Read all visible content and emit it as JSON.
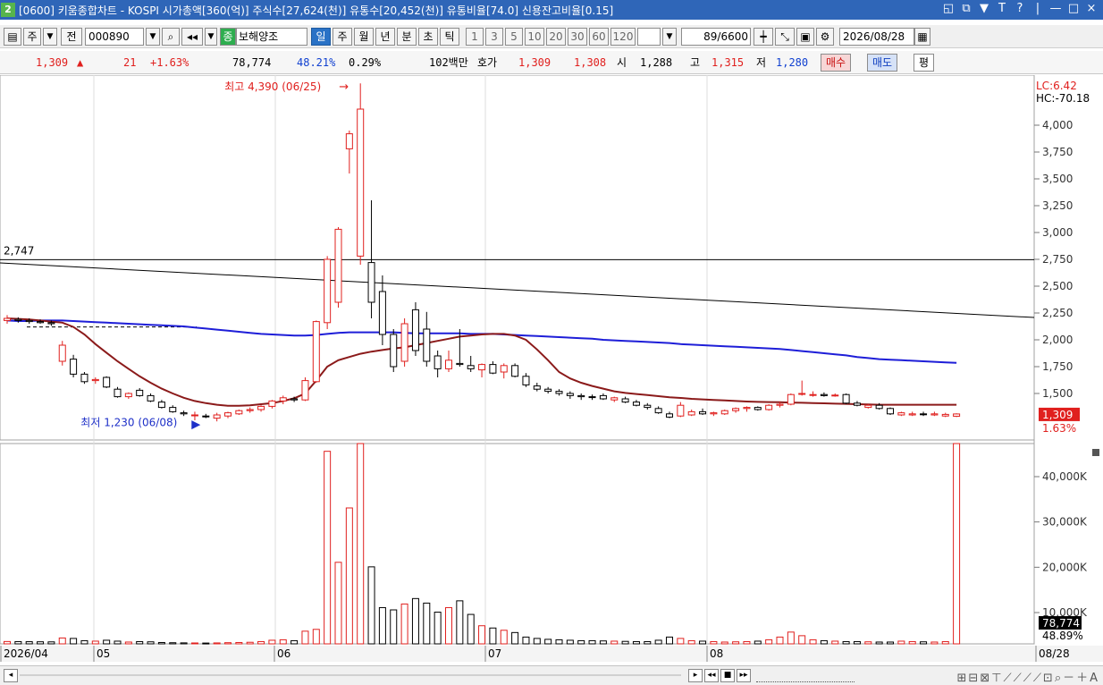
{
  "window": {
    "badge": "2",
    "title": "[0600] 키움종합차트 - KOSPI 시가총액[360(억)] 주식수[27,624(천)] 유통수[20,452(천)] 유통비율[74.0] 신용잔고비율[0.15]",
    "controls": [
      "◱",
      "⧉",
      "▼",
      "T",
      "?",
      "|",
      "—",
      "□",
      "×"
    ]
  },
  "toolbar": {
    "market": "주",
    "all_label": "전",
    "code": "000890",
    "stock_name": "보해양조",
    "badge_label": "종",
    "periods": [
      "일",
      "주",
      "월",
      "년",
      "분",
      "초",
      "틱"
    ],
    "selected_period": "일",
    "intervals": [
      "1",
      "3",
      "5",
      "10",
      "20",
      "30",
      "60",
      "120"
    ],
    "count": "89",
    "count_total": "/6600",
    "date": "2026/08/28"
  },
  "quote": {
    "price": "1,309",
    "change_arrow": "▲",
    "change": "21",
    "change_pct": "+1.63%",
    "volume": "78,774",
    "volume_ratio": "48.21%",
    "turnover": "0.29%",
    "trade_value": "102백만",
    "hoga_label": "호가",
    "ask": "1,309",
    "bid": "1,308",
    "open_label": "시",
    "open": "1,288",
    "high_label": "고",
    "high": "1,315",
    "low_label": "저",
    "low": "1,280",
    "buy_label": "매수",
    "sell_label": "매도",
    "eval_label": "평"
  },
  "price_axis": {
    "labels": [
      "4,000",
      "3,750",
      "3,500",
      "3,250",
      "3,000",
      "2,750",
      "2,500",
      "2,250",
      "2,000",
      "1,750",
      "1,500"
    ],
    "lc": "LC:6.42",
    "hc": "HC:-70.18",
    "current": "1,309",
    "current_pct": "1.63%"
  },
  "volume_axis": {
    "labels": [
      "40,000K",
      "30,000K",
      "20,000K",
      "10,000K"
    ],
    "current": "78,774",
    "current_pct": "48.89%"
  },
  "date_axis": [
    "2026/04",
    "05",
    "06",
    "07",
    "08",
    "08/28"
  ],
  "annotations": {
    "high": "최고 4,390 (06/25)",
    "low": "최저 1,230 (06/08)",
    "hline": "2,747"
  },
  "colors": {
    "up": "#e0201e",
    "down": "#000000",
    "ma_short": "#8b1a1a",
    "ma_long": "#1e1ed8",
    "title_bar": "#2f66b8"
  },
  "chart_data": {
    "type": "candlestick",
    "y_range": [
      1100,
      4600
    ],
    "volume_range_k": [
      0,
      46000
    ],
    "candles": [
      {
        "o": 2180,
        "h": 2230,
        "l": 2150,
        "c": 2200
      },
      {
        "o": 2190,
        "h": 2210,
        "l": 2160,
        "c": 2180
      },
      {
        "o": 2180,
        "h": 2200,
        "l": 2150,
        "c": 2170
      },
      {
        "o": 2170,
        "h": 2190,
        "l": 2150,
        "c": 2160
      },
      {
        "o": 2160,
        "h": 2180,
        "l": 2130,
        "c": 2150
      },
      {
        "o": 1800,
        "h": 1990,
        "l": 1760,
        "c": 1950
      },
      {
        "o": 1820,
        "h": 1860,
        "l": 1650,
        "c": 1680
      },
      {
        "o": 1680,
        "h": 1700,
        "l": 1590,
        "c": 1610
      },
      {
        "o": 1620,
        "h": 1650,
        "l": 1590,
        "c": 1630
      },
      {
        "o": 1650,
        "h": 1660,
        "l": 1550,
        "c": 1560
      },
      {
        "o": 1540,
        "h": 1560,
        "l": 1460,
        "c": 1470
      },
      {
        "o": 1470,
        "h": 1510,
        "l": 1450,
        "c": 1500
      },
      {
        "o": 1530,
        "h": 1550,
        "l": 1470,
        "c": 1480
      },
      {
        "o": 1480,
        "h": 1500,
        "l": 1420,
        "c": 1430
      },
      {
        "o": 1420,
        "h": 1440,
        "l": 1360,
        "c": 1370
      },
      {
        "o": 1370,
        "h": 1390,
        "l": 1320,
        "c": 1330
      },
      {
        "o": 1320,
        "h": 1340,
        "l": 1290,
        "c": 1310
      },
      {
        "o": 1300,
        "h": 1330,
        "l": 1250,
        "c": 1300
      },
      {
        "o": 1290,
        "h": 1310,
        "l": 1270,
        "c": 1285
      },
      {
        "o": 1270,
        "h": 1320,
        "l": 1240,
        "c": 1300
      },
      {
        "o": 1290,
        "h": 1330,
        "l": 1270,
        "c": 1320
      },
      {
        "o": 1310,
        "h": 1350,
        "l": 1300,
        "c": 1340
      },
      {
        "o": 1340,
        "h": 1370,
        "l": 1320,
        "c": 1350
      },
      {
        "o": 1350,
        "h": 1390,
        "l": 1330,
        "c": 1380
      },
      {
        "o": 1380,
        "h": 1440,
        "l": 1360,
        "c": 1430
      },
      {
        "o": 1430,
        "h": 1480,
        "l": 1400,
        "c": 1460
      },
      {
        "o": 1450,
        "h": 1470,
        "l": 1420,
        "c": 1440
      },
      {
        "o": 1440,
        "h": 1650,
        "l": 1430,
        "c": 1620
      },
      {
        "o": 1610,
        "h": 2180,
        "l": 1600,
        "c": 2170
      },
      {
        "o": 2160,
        "h": 2780,
        "l": 2100,
        "c": 2750
      },
      {
        "o": 2350,
        "h": 3050,
        "l": 2300,
        "c": 3030
      },
      {
        "o": 3780,
        "h": 3950,
        "l": 3550,
        "c": 3920
      },
      {
        "o": 2780,
        "h": 4390,
        "l": 2700,
        "c": 4150
      },
      {
        "o": 2720,
        "h": 3300,
        "l": 2200,
        "c": 2350
      },
      {
        "o": 2450,
        "h": 2600,
        "l": 1950,
        "c": 2050
      },
      {
        "o": 2050,
        "h": 2100,
        "l": 1700,
        "c": 1750
      },
      {
        "o": 1800,
        "h": 2200,
        "l": 1750,
        "c": 2150
      },
      {
        "o": 2280,
        "h": 2350,
        "l": 1850,
        "c": 1900
      },
      {
        "o": 2100,
        "h": 2260,
        "l": 1750,
        "c": 1800
      },
      {
        "o": 1850,
        "h": 1900,
        "l": 1650,
        "c": 1730
      },
      {
        "o": 1730,
        "h": 1900,
        "l": 1700,
        "c": 1810
      },
      {
        "o": 1780,
        "h": 2100,
        "l": 1750,
        "c": 1770
      },
      {
        "o": 1760,
        "h": 1850,
        "l": 1700,
        "c": 1730
      },
      {
        "o": 1720,
        "h": 1780,
        "l": 1650,
        "c": 1770
      },
      {
        "o": 1770,
        "h": 1800,
        "l": 1680,
        "c": 1690
      },
      {
        "o": 1700,
        "h": 1780,
        "l": 1640,
        "c": 1760
      },
      {
        "o": 1760,
        "h": 1780,
        "l": 1650,
        "c": 1660
      },
      {
        "o": 1660,
        "h": 1690,
        "l": 1560,
        "c": 1580
      },
      {
        "o": 1570,
        "h": 1600,
        "l": 1520,
        "c": 1540
      },
      {
        "o": 1540,
        "h": 1560,
        "l": 1500,
        "c": 1520
      },
      {
        "o": 1520,
        "h": 1540,
        "l": 1480,
        "c": 1500
      },
      {
        "o": 1500,
        "h": 1520,
        "l": 1450,
        "c": 1480
      },
      {
        "o": 1480,
        "h": 1500,
        "l": 1440,
        "c": 1470
      },
      {
        "o": 1470,
        "h": 1490,
        "l": 1440,
        "c": 1465
      },
      {
        "o": 1480,
        "h": 1500,
        "l": 1440,
        "c": 1450
      },
      {
        "o": 1440,
        "h": 1470,
        "l": 1420,
        "c": 1460
      },
      {
        "o": 1450,
        "h": 1470,
        "l": 1410,
        "c": 1420
      },
      {
        "o": 1420,
        "h": 1440,
        "l": 1380,
        "c": 1390
      },
      {
        "o": 1390,
        "h": 1410,
        "l": 1350,
        "c": 1370
      },
      {
        "o": 1360,
        "h": 1380,
        "l": 1310,
        "c": 1320
      },
      {
        "o": 1310,
        "h": 1330,
        "l": 1270,
        "c": 1280
      },
      {
        "o": 1290,
        "h": 1420,
        "l": 1280,
        "c": 1390
      },
      {
        "o": 1300,
        "h": 1350,
        "l": 1290,
        "c": 1330
      },
      {
        "o": 1330,
        "h": 1360,
        "l": 1300,
        "c": 1310
      },
      {
        "o": 1310,
        "h": 1330,
        "l": 1290,
        "c": 1320
      },
      {
        "o": 1310,
        "h": 1350,
        "l": 1300,
        "c": 1340
      },
      {
        "o": 1340,
        "h": 1370,
        "l": 1320,
        "c": 1360
      },
      {
        "o": 1360,
        "h": 1380,
        "l": 1330,
        "c": 1370
      },
      {
        "o": 1370,
        "h": 1380,
        "l": 1340,
        "c": 1350
      },
      {
        "o": 1350,
        "h": 1400,
        "l": 1340,
        "c": 1390
      },
      {
        "o": 1390,
        "h": 1420,
        "l": 1370,
        "c": 1400
      },
      {
        "o": 1400,
        "h": 1500,
        "l": 1390,
        "c": 1490
      },
      {
        "o": 1500,
        "h": 1620,
        "l": 1480,
        "c": 1500
      },
      {
        "o": 1490,
        "h": 1520,
        "l": 1470,
        "c": 1490
      },
      {
        "o": 1490,
        "h": 1510,
        "l": 1470,
        "c": 1480
      },
      {
        "o": 1480,
        "h": 1500,
        "l": 1470,
        "c": 1485
      },
      {
        "o": 1490,
        "h": 1500,
        "l": 1400,
        "c": 1410
      },
      {
        "o": 1410,
        "h": 1430,
        "l": 1380,
        "c": 1390
      },
      {
        "o": 1370,
        "h": 1400,
        "l": 1360,
        "c": 1390
      },
      {
        "o": 1390,
        "h": 1410,
        "l": 1350,
        "c": 1360
      },
      {
        "o": 1360,
        "h": 1370,
        "l": 1300,
        "c": 1310
      },
      {
        "o": 1300,
        "h": 1330,
        "l": 1290,
        "c": 1320
      },
      {
        "o": 1300,
        "h": 1330,
        "l": 1290,
        "c": 1310
      },
      {
        "o": 1310,
        "h": 1330,
        "l": 1290,
        "c": 1305
      },
      {
        "o": 1300,
        "h": 1330,
        "l": 1290,
        "c": 1310
      },
      {
        "o": 1290,
        "h": 1320,
        "l": 1280,
        "c": 1305
      },
      {
        "o": 1288,
        "h": 1315,
        "l": 1280,
        "c": 1309
      }
    ],
    "volumes_k": [
      520,
      500,
      480,
      460,
      440,
      1300,
      1200,
      700,
      600,
      800,
      600,
      400,
      500,
      450,
      300,
      250,
      220,
      200,
      180,
      210,
      260,
      300,
      350,
      500,
      800,
      900,
      700,
      2800,
      3200,
      42500,
      18000,
      30000,
      46000,
      17000,
      8000,
      7500,
      8800,
      10000,
      9000,
      7000,
      8000,
      9500,
      6500,
      4000,
      3500,
      3000,
      2500,
      1500,
      1200,
      1000,
      900,
      800,
      700,
      700,
      650,
      600,
      550,
      500,
      500,
      800,
      1500,
      1200,
      700,
      600,
      500,
      400,
      450,
      500,
      600,
      900,
      1500,
      2600,
      1800,
      900,
      700,
      600,
      500,
      500,
      450,
      400,
      400,
      600,
      500,
      450,
      400,
      500,
      78774
    ],
    "ma_short": [
      2200,
      2195,
      2190,
      2180,
      2170,
      2160,
      2120,
      2050,
      1960,
      1880,
      1800,
      1730,
      1660,
      1600,
      1545,
      1500,
      1460,
      1430,
      1410,
      1395,
      1385,
      1385,
      1390,
      1400,
      1410,
      1430,
      1455,
      1500,
      1620,
      1750,
      1810,
      1840,
      1870,
      1890,
      1905,
      1920,
      1930,
      1950,
      1970,
      1990,
      2010,
      2030,
      2040,
      2050,
      2055,
      2055,
      2040,
      2000,
      1910,
      1810,
      1700,
      1640,
      1600,
      1570,
      1545,
      1520,
      1505,
      1495,
      1485,
      1475,
      1465,
      1458,
      1450,
      1445,
      1440,
      1435,
      1430,
      1425,
      1422,
      1420,
      1418,
      1415,
      1413,
      1410,
      1408,
      1405,
      1403,
      1400,
      1398,
      1395,
      1395,
      1395,
      1395,
      1395,
      1395,
      1395,
      1395
    ],
    "ma_long": [
      2180,
      2175,
      2175,
      2180,
      2180,
      2180,
      2175,
      2170,
      2165,
      2160,
      2155,
      2150,
      2145,
      2140,
      2135,
      2130,
      2125,
      2115,
      2105,
      2095,
      2085,
      2075,
      2065,
      2055,
      2050,
      2045,
      2040,
      2040,
      2045,
      2055,
      2065,
      2070,
      2070,
      2070,
      2070,
      2070,
      2065,
      2060,
      2060,
      2060,
      2060,
      2060,
      2055,
      2055,
      2055,
      2050,
      2045,
      2040,
      2035,
      2030,
      2025,
      2020,
      2015,
      2010,
      2000,
      1995,
      1990,
      1985,
      1980,
      1975,
      1970,
      1960,
      1955,
      1950,
      1945,
      1940,
      1935,
      1930,
      1925,
      1920,
      1915,
      1905,
      1895,
      1885,
      1875,
      1865,
      1855,
      1840,
      1830,
      1820,
      1815,
      1810,
      1805,
      1800,
      1795,
      1790,
      1785
    ]
  }
}
